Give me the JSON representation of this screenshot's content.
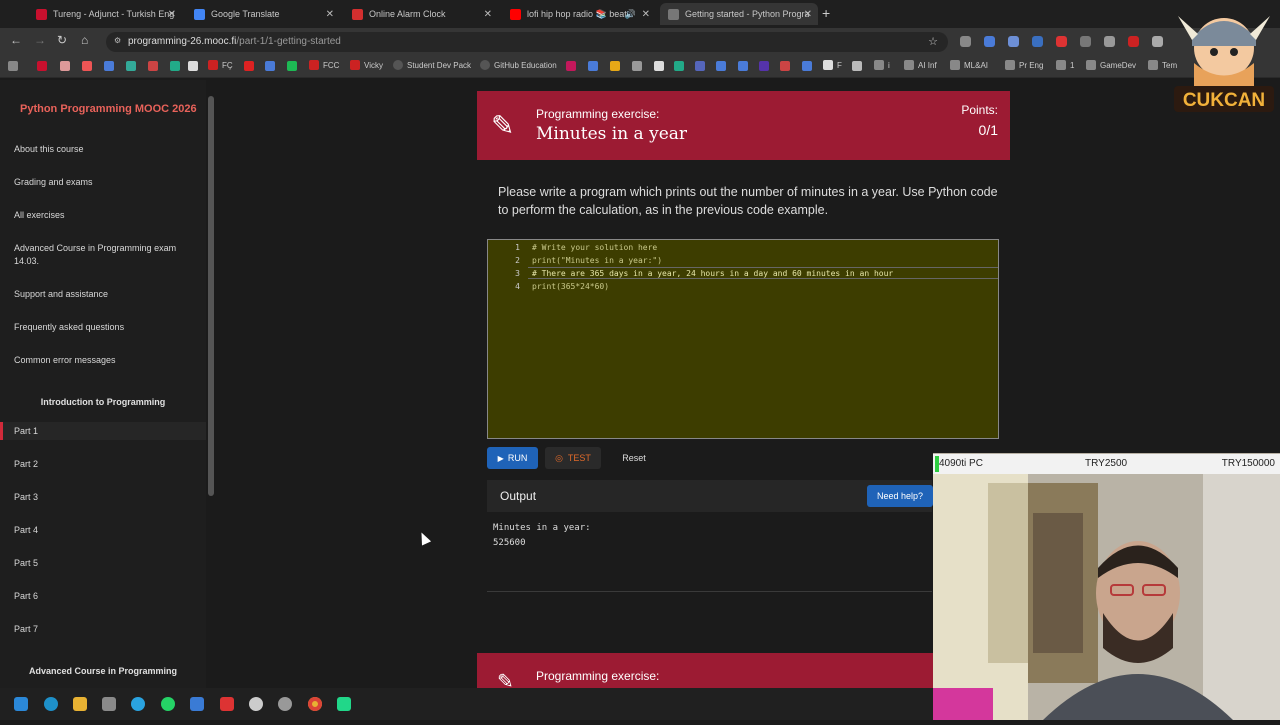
{
  "browser": {
    "tabs": [
      {
        "label": "Tureng - Adjunct - Turkish Eng",
        "color": "#c8102e"
      },
      {
        "label": "Google Translate",
        "color": "#4285f4"
      },
      {
        "label": "Online Alarm Clock",
        "color": "#d32f2f"
      },
      {
        "label": "lofi hip hop radio 📚 beats",
        "color": "#ff0000"
      },
      {
        "label": "Getting started - Python Progra",
        "color": "#777777"
      }
    ],
    "url_host": "programming-26.mooc.fi",
    "url_path": "/part-1/1-getting-started",
    "bookmarks": [
      "FÇ",
      "FCC",
      "Vicky",
      "Student Dev Pack",
      "GitHub Education",
      "F",
      "i",
      "AI Inf",
      "ML&AI",
      "Pr Eng",
      "1",
      "GameDev",
      "Tem"
    ]
  },
  "sidebar": {
    "title": "Python Programming MOOC 2026",
    "items": [
      "About this course",
      "Grading and exams",
      "All exercises",
      "Advanced Course in Programming exam 14.03.",
      "Support and assistance",
      "Frequently asked questions",
      "Common error messages"
    ],
    "section1": "Introduction to Programming",
    "parts": [
      "Part 1",
      "Part 2",
      "Part 3",
      "Part 4",
      "Part 5",
      "Part 6",
      "Part 7"
    ],
    "section2": "Advanced Course in Programming"
  },
  "exercise": {
    "kind": "Programming exercise:",
    "name": "Minutes in a year",
    "points_label": "Points:",
    "points_value": "0/1",
    "description": "Please write a program which prints out the number of minutes in a year. Use Python code to perform the calculation, as in the previous code example.",
    "code_lines": [
      {
        "n": "1",
        "text": "# Write your solution here"
      },
      {
        "n": "2",
        "text": "print(\"Minutes in a year:\")"
      },
      {
        "n": "3",
        "text": "# There are 365 days in a year, 24 hours in a day and 60 minutes in an hour"
      },
      {
        "n": "4",
        "text": "print(365*24*60)"
      }
    ],
    "run_label": "RUN",
    "test_label": "TEST",
    "reset_label": "Reset",
    "output_title": "Output",
    "help_label": "Need help?",
    "output_lines": [
      "Minutes in a year:",
      "525600"
    ]
  },
  "next_exercise": {
    "kind": "Programming exercise:"
  },
  "overlay": {
    "logo_text": "CUKCAN",
    "pc_label": "4090ti PC",
    "goal1": "TRY2500",
    "goal2": "TRY150000"
  }
}
